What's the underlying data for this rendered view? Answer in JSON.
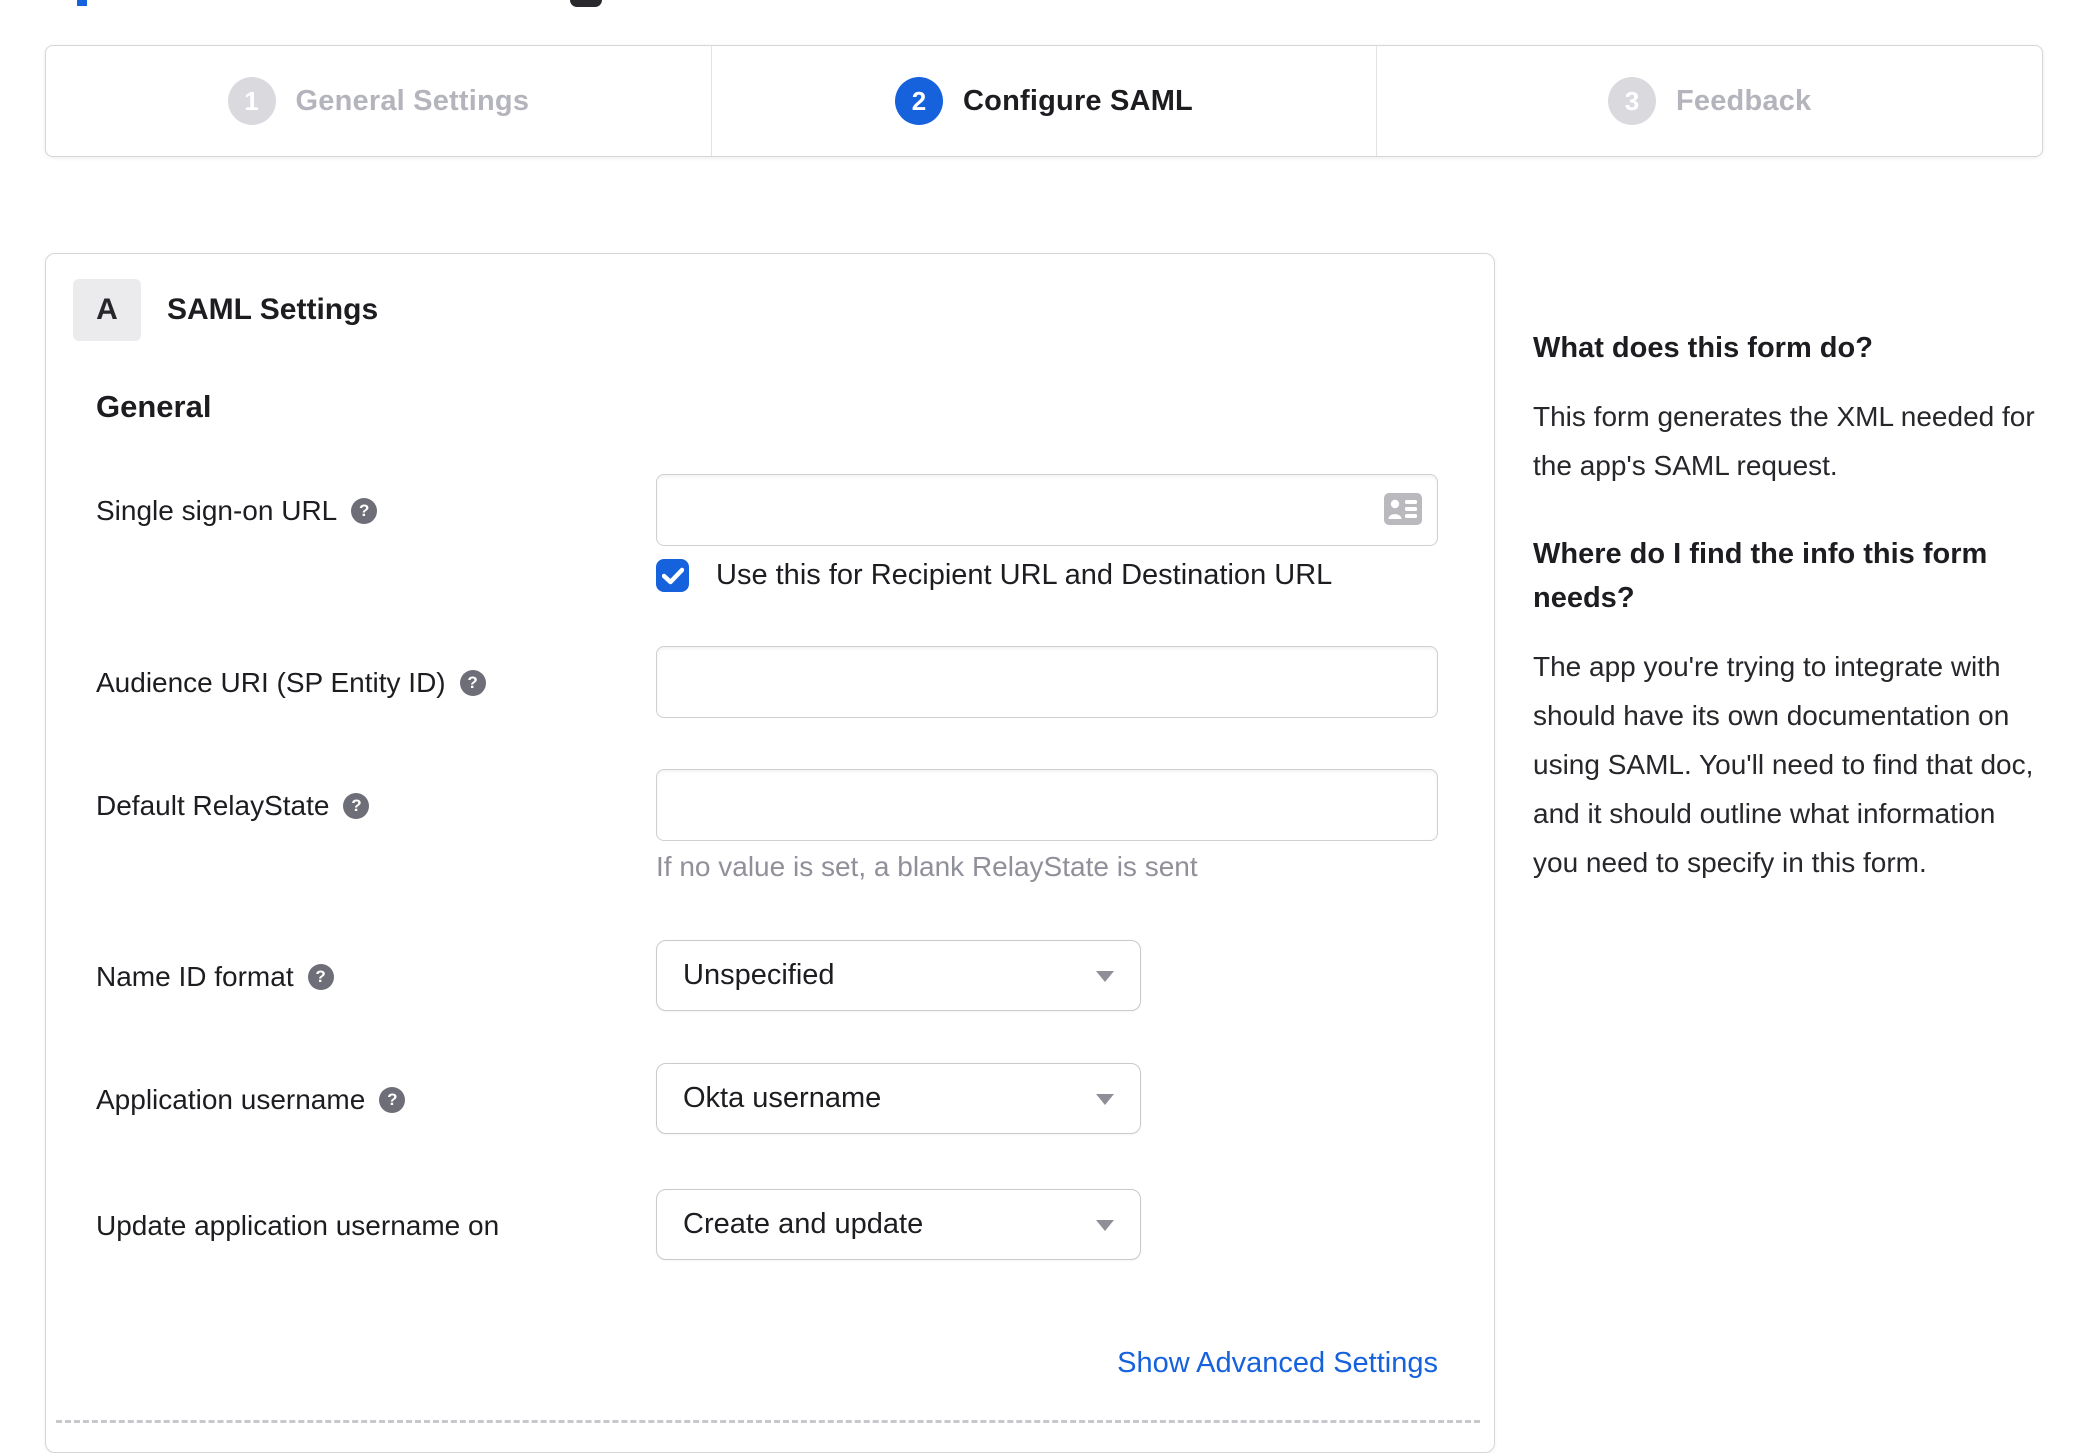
{
  "stepper": {
    "steps": [
      {
        "number": "1",
        "label": "General Settings",
        "state": "inactive"
      },
      {
        "number": "2",
        "label": "Configure SAML",
        "state": "active"
      },
      {
        "number": "3",
        "label": "Feedback",
        "state": "inactive"
      }
    ]
  },
  "panel": {
    "section_badge": "A",
    "section_title": "SAML Settings",
    "subsection_title": "General",
    "fields": [
      {
        "label": "Single sign-on URL",
        "type": "text",
        "value": "",
        "checkbox_checked": true,
        "checkbox_label": "Use this for Recipient URL and Destination URL"
      },
      {
        "label": "Audience URI (SP Entity ID)",
        "type": "text",
        "value": ""
      },
      {
        "label": "Default RelayState",
        "type": "text",
        "value": "",
        "hint": "If no value is set, a blank RelayState is sent"
      },
      {
        "label": "Name ID format",
        "type": "select",
        "value": "Unspecified"
      },
      {
        "label": "Application username",
        "type": "select",
        "value": "Okta username"
      },
      {
        "label": "Update application username on",
        "type": "select",
        "value": "Create and update"
      }
    ],
    "advanced_link": "Show Advanced Settings"
  },
  "sidebar": {
    "blocks": [
      {
        "heading": "What does this form do?",
        "text": "This form generates the XML needed for the app's SAML request."
      },
      {
        "heading": "Where do I find the info this form needs?",
        "text": "The app you're trying to integrate with should have its own documentation on using SAML. You'll need to find that doc, and it should outline what information you need to specify in this form."
      }
    ]
  },
  "colors": {
    "accent_blue": "#1662dd",
    "inactive_step_gray": "#d9d9de",
    "inactive_text_gray": "#b4b4bc",
    "text_dark": "#1d1d21",
    "hint_gray": "#90909a",
    "border_gray": "#d6d6da"
  }
}
